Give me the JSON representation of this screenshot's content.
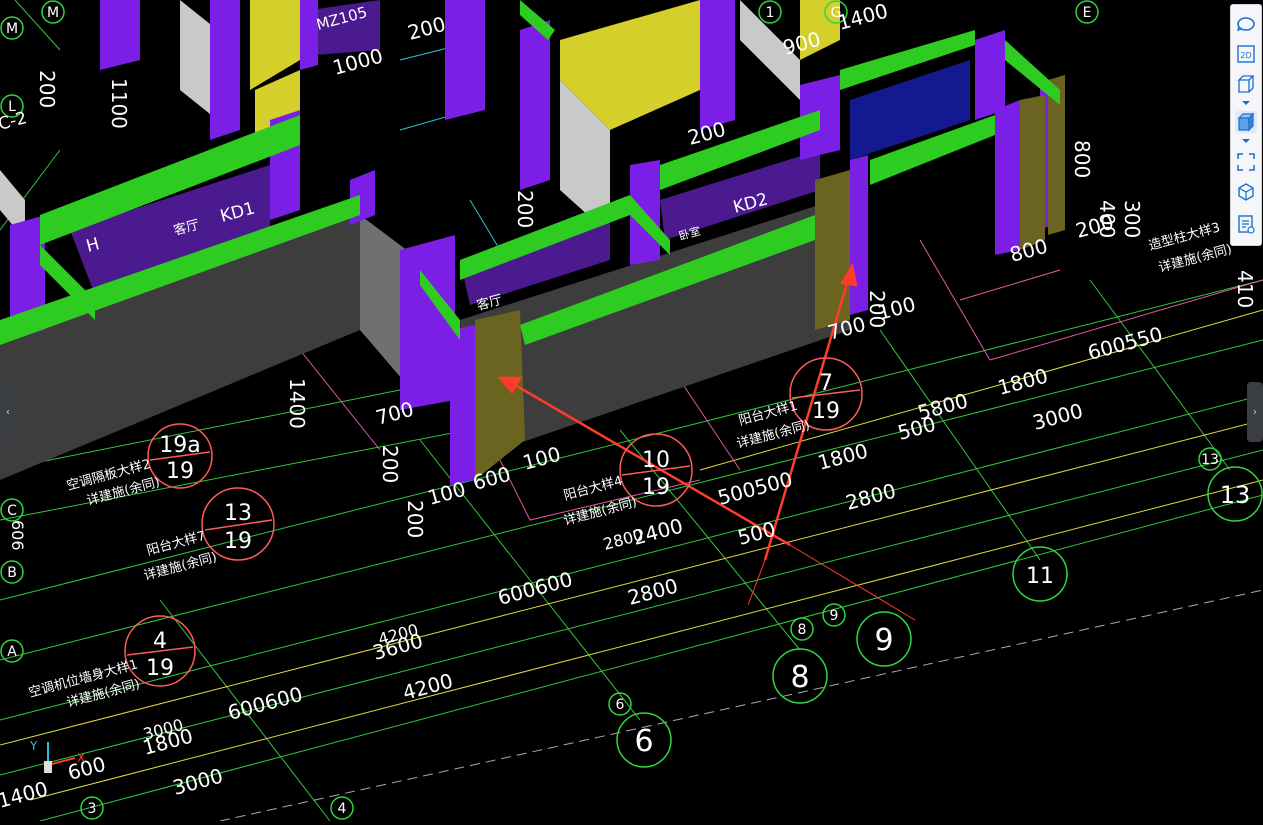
{
  "axis_labels": {
    "grid_letters": [
      "M",
      "M",
      "L",
      "E",
      "G",
      "1",
      "C",
      "B",
      "A"
    ],
    "grid_numbers": [
      "13",
      "13",
      "11",
      "9",
      "9",
      "8",
      "8",
      "6",
      "6",
      "3",
      "4"
    ]
  },
  "dims": {
    "d_2000_a": "200",
    "d_1000": "1000",
    "d_2000_b": "200",
    "d_1100": "1100",
    "d_200_left": "200",
    "d_1400_top": "1400",
    "d_900": "900",
    "d_200_mid": "200",
    "d_200_center": "200",
    "d_800_top": "800",
    "d_400": "400",
    "d_800_right": "800",
    "d_200_right": "200",
    "d_300": "300",
    "d_410": "410",
    "d_700_a": "700",
    "d_100_a": "100",
    "d_200_b": "200",
    "d_1800_a": "1800",
    "d_600550": "600550",
    "d_500": "500",
    "d_5800": "5800",
    "d_3000_a": "3000",
    "d_1800_b": "1800",
    "d_2800_a": "2800",
    "d_500_500": "500500",
    "d_500_c": "500",
    "d_600_a": "600",
    "d_100_b": "100",
    "d_1400_b": "1400",
    "d_700_b": "700",
    "d_200_c": "200",
    "d_200_d": "200",
    "d_100_c": "100",
    "d_2400": "2400",
    "d_2800_b": "2800",
    "d_2800_c": "2800",
    "d_600600_a": "600600",
    "d_4200_a": "4200",
    "d_3600": "3600",
    "d_4200_b": "4200",
    "d_600600_b": "600600",
    "d_3000_b": "3000",
    "d_1800_c": "1800",
    "d_3000_c": "3000",
    "d_600_b": "600",
    "d_1400_c": "1400",
    "d_606": "606",
    "d_2_m": "2"
  },
  "annotations": {
    "ac_board_1": "空调隔板大样2",
    "ac_board_1_ref": "详建施(余同)",
    "ac_board_1_num": "19a",
    "ac_board_1_den": "19",
    "balcony_7": "阳台大样7",
    "balcony_7_ref": "详建施(余同)",
    "balcony_7_num": "13",
    "balcony_7_den": "19",
    "ac_wall": "空调机位墙身大样1",
    "ac_wall_ref": "详建施(余同)",
    "ac_wall_num": "4",
    "ac_wall_den": "19",
    "balcony_4": "阳台大样4",
    "balcony_4_ref": "详建施(余同)",
    "balcony_4_num": "10",
    "balcony_4_den": "19",
    "balcony_1": "阳台大样1",
    "balcony_1_ref": "详建施(余同)",
    "balcony_1_num": "7",
    "balcony_1_den": "19",
    "column_3": "造型柱大样3",
    "column_3_ref": "详建施(余同)",
    "room_living_a": "客厅",
    "room_living_b": "客厅",
    "room_kd1": "KD1",
    "room_kd2": "KD2",
    "room_h": "H",
    "room_mz": "MZ105",
    "room_bed": "卧室",
    "label_c2": "C-2",
    "label_400": "400",
    "label_1_1": "1"
  },
  "toolbar": {
    "items": [
      "orbit-icon",
      "2d-view-icon",
      "3d-box-icon",
      "3d-solid-icon",
      "fullscreen-icon",
      "layers-icon",
      "report-icon"
    ],
    "label_2d": "2D"
  },
  "ucs": {
    "x": "X",
    "y": "Y"
  },
  "side_tabs": {
    "left": "‹",
    "right": "›"
  },
  "colors": {
    "background": "#000000",
    "wall_purple": "#7b1ee6",
    "beam_green": "#2ecc21",
    "slab_gray": "#3d3d3d",
    "column_olive": "#6b6420",
    "wall_yellow": "#d4cf2a",
    "grid_line": "#2fd53f",
    "annotation_red": "#ff3b2a",
    "dim_white": "#ffffff",
    "circle_red": "#ff5b5b"
  }
}
